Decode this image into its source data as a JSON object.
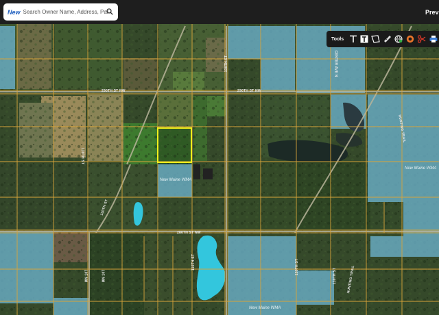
{
  "search": {
    "badge": "New",
    "placeholder": "Search Owner Name, Address, Parcel Id"
  },
  "header": {
    "preview_label": "Previ"
  },
  "toolbar": {
    "label": "Tools",
    "tools": [
      "text-icon",
      "text-box-icon",
      "polygon-icon",
      "ruler-icon",
      "globe-icon",
      "buffer-icon",
      "scissors-icon",
      "print-icon"
    ]
  },
  "map": {
    "road_labels": {
      "r1": "290TH ST NW",
      "r2": "290TH ST NW",
      "r3": "280TH ST NW",
      "r4": "130TH ST",
      "r5": "130TH ST",
      "r6": "CENTER AVE N",
      "r7": "HUNTING TRAIL",
      "r8": "130TH ST",
      "r9": "110TH ST",
      "r10": "130TH ST",
      "r11": "HUNTING TRAIL",
      "r12": "MN 107",
      "r13": "MN 107",
      "r14": "130TH ST"
    },
    "wma_labels": {
      "w1": "New Maine WMA",
      "w2": "New Maine WMA",
      "w3": "New Maine WMA"
    }
  },
  "colors": {
    "parcel_line": "#d8a43a",
    "selected_parcel": "#f2ef1c",
    "wma_fill": "#6fb7d4",
    "water": "#34c4dd"
  }
}
